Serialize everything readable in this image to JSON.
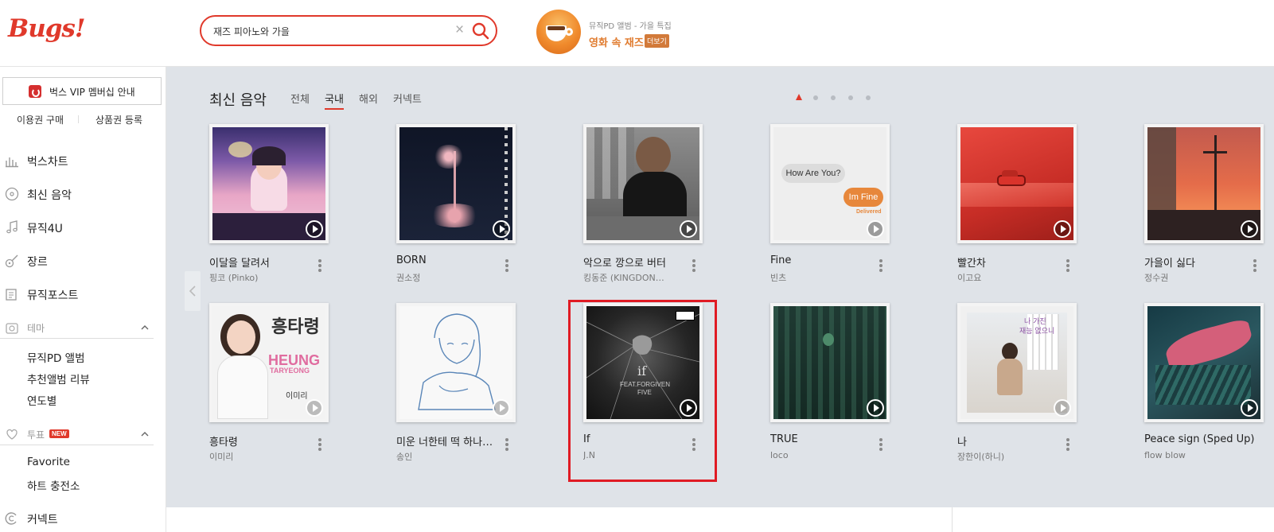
{
  "header": {
    "logo": "Bugs!",
    "search": {
      "value": "재즈 피아노와 가을",
      "clear_icon": "×"
    },
    "promo": {
      "subtitle": "뮤직PD 앨범 - 가을 특집",
      "title": "영화 속 재즈",
      "more": "더보기"
    }
  },
  "sidebar": {
    "vip": "벅스 VIP 멤버십 안내",
    "buy": "이용권 구매",
    "register": "상품권 등록",
    "nav": [
      {
        "label": "벅스차트",
        "icon": "chart-icon"
      },
      {
        "label": "최신 음악",
        "icon": "disc-icon"
      },
      {
        "label": "뮤직4U",
        "icon": "music-note-icon"
      },
      {
        "label": "장르",
        "icon": "guitar-icon"
      },
      {
        "label": "뮤직포스트",
        "icon": "post-icon"
      }
    ],
    "theme": {
      "label": "테마",
      "items": [
        "뮤직PD 앨범",
        "추천앨범 리뷰",
        "연도별"
      ]
    },
    "vote": {
      "label": "투표",
      "badge": "NEW",
      "items": [
        "Favorite",
        "하트 충전소"
      ]
    },
    "connect": "커넥트"
  },
  "main": {
    "title": "최신 음악",
    "tabs": [
      "전체",
      "국내",
      "해외",
      "커넥트"
    ],
    "active_tab": 1,
    "pager": {
      "pages": 5,
      "current": 1
    },
    "albums": [
      {
        "title": "이달을 달려서",
        "artist": "핑코 (Pinko)"
      },
      {
        "title": "BORN",
        "artist": "권소정"
      },
      {
        "title": "악으로 깡으로 버터",
        "artist": "킹동준 (KINGDON…"
      },
      {
        "title": "Fine",
        "artist": "빈츠",
        "bubble1": "How Are You?",
        "bubble2": "Im Fine",
        "delivered": "Delivered"
      },
      {
        "title": "빨간차",
        "artist": "이고요"
      },
      {
        "title": "가을이 싫다",
        "artist": "정수권"
      },
      {
        "title": "흥타령",
        "artist": "이미리",
        "cover_text1": "흥타령",
        "cover_text2": "HEUNG",
        "cover_text3": "TARYEONG",
        "cover_text4": "이미리"
      },
      {
        "title": "미운 너한테 떡 하나를 …",
        "artist": "송인"
      },
      {
        "title": "If",
        "artist": "J.N",
        "cover_text1": "if",
        "cover_text2": "FEAT.FORGIVEN",
        "cover_text3": "FIVE"
      },
      {
        "title": "TRUE",
        "artist": "loco"
      },
      {
        "title": "나",
        "artist": "장한이(하니)",
        "cover_text1": "나 가진",
        "cover_text2": "재능 없으니"
      },
      {
        "title": "Peace sign (Sped Up)",
        "artist": "flow blow"
      }
    ]
  }
}
